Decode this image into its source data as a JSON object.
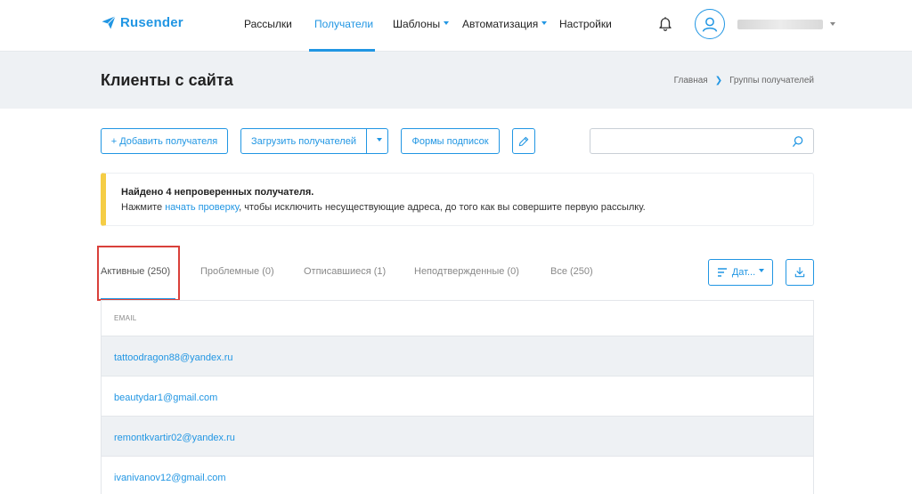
{
  "brand": {
    "name": "Rusender",
    "color": "#2196e3",
    "icon": "paper-plane-icon"
  },
  "nav": {
    "items": [
      {
        "label": "Рассылки",
        "has_dropdown": false
      },
      {
        "label": "Получатели",
        "has_dropdown": false,
        "active": true
      },
      {
        "label": "Шаблоны",
        "has_dropdown": true
      },
      {
        "label": "Автоматизация",
        "has_dropdown": true
      },
      {
        "label": "Настройки",
        "has_dropdown": false
      }
    ]
  },
  "user": {
    "icon": "user-icon",
    "notification_icon": "bell-icon"
  },
  "page": {
    "title": "Клиенты с сайта"
  },
  "breadcrumb": {
    "items": [
      "Главная",
      "Группы получателей"
    ]
  },
  "toolbar": {
    "add_label": "+ Добавить получателя",
    "upload_label": "Загрузить получателей",
    "forms_label": "Формы подписок",
    "search_placeholder": ""
  },
  "alert": {
    "title": "Найдено 4 непроверенных получателя.",
    "text_before": "Нажмите ",
    "link": "начать проверку",
    "text_after": ", чтобы исключить несуществующие адреса, до того как вы совершите первую рассылку.",
    "accent": "#f5cd45"
  },
  "tabs": [
    {
      "label": "Активные (250)",
      "active": true
    },
    {
      "label": "Проблемные (0)"
    },
    {
      "label": "Отписавшиеся (1)"
    },
    {
      "label": "Неподтвержденные (0)"
    },
    {
      "label": "Все (250)"
    }
  ],
  "sort": {
    "label": "Дат..."
  },
  "table": {
    "columns": [
      "EMAIL"
    ],
    "rows": [
      {
        "email": "tattoodragon88@yandex.ru"
      },
      {
        "email": "beautydar1@gmail.com"
      },
      {
        "email": "remontkvartir02@yandex.ru"
      },
      {
        "email": "ivanivanov12@gmail.com"
      }
    ]
  },
  "colors": {
    "accent": "#2196e3",
    "highlight": "#d9403a",
    "band": "#eef1f4"
  }
}
